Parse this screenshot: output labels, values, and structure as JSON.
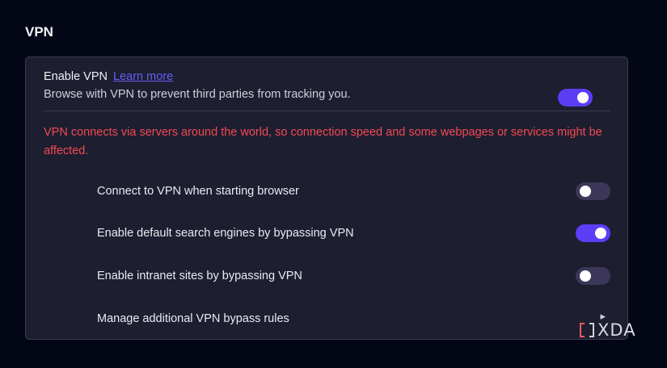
{
  "section": {
    "title": "VPN"
  },
  "enable_vpn": {
    "title": "Enable VPN",
    "learn_more": "Learn more",
    "description": "Browse with VPN to prevent third parties from tracking you.",
    "enabled": true
  },
  "warning": "VPN connects via servers around the world, so connection speed and some webpages or services might be affected.",
  "options": [
    {
      "label": "Connect to VPN when starting browser",
      "enabled": false
    },
    {
      "label": "Enable default search engines by bypassing VPN",
      "enabled": true
    },
    {
      "label": "Enable intranet sites by bypassing VPN",
      "enabled": false
    },
    {
      "label": "Manage additional VPN bypass rules",
      "icon": "chevron-right-icon"
    }
  ],
  "watermark": {
    "text": "XDA"
  },
  "colors": {
    "accent": "#5b3ef5",
    "toggle_off": "#3c3758",
    "warning": "#f24a52",
    "link": "#6a5cf6",
    "card": "#1d1e30",
    "background": "#030614"
  }
}
